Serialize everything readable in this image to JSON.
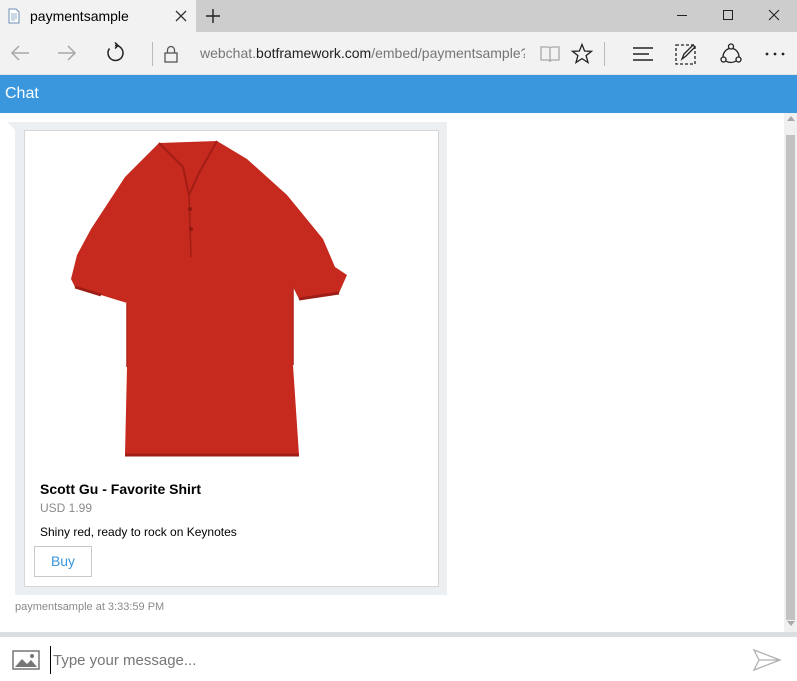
{
  "browser": {
    "tab_title": "paymentsample",
    "url": {
      "prefix": "webchat.",
      "host": "botframework.com",
      "path": "/embed/paymentsample?s="
    },
    "icons": [
      "page-icon",
      "close-icon",
      "plus-icon",
      "minimize-icon",
      "maximize-icon",
      "window-close-icon",
      "back-icon",
      "forward-icon",
      "refresh-icon",
      "lock-icon",
      "reading-view-icon",
      "star-icon",
      "hub-icon",
      "web-note-icon",
      "share-icon",
      "more-icon"
    ]
  },
  "chat": {
    "title": "Chat",
    "card": {
      "title": "Scott Gu - Favorite Shirt",
      "subtitle": "USD 1.99",
      "text": "Shiny red, ready to rock on Keynotes",
      "button_label": "Buy"
    },
    "timestamp": "paymentsample at 3:33:59 PM"
  },
  "composer": {
    "placeholder": "Type your message...",
    "value": ""
  },
  "colors": {
    "accent": "#3a96dd",
    "shirt": "#c62a1f"
  }
}
